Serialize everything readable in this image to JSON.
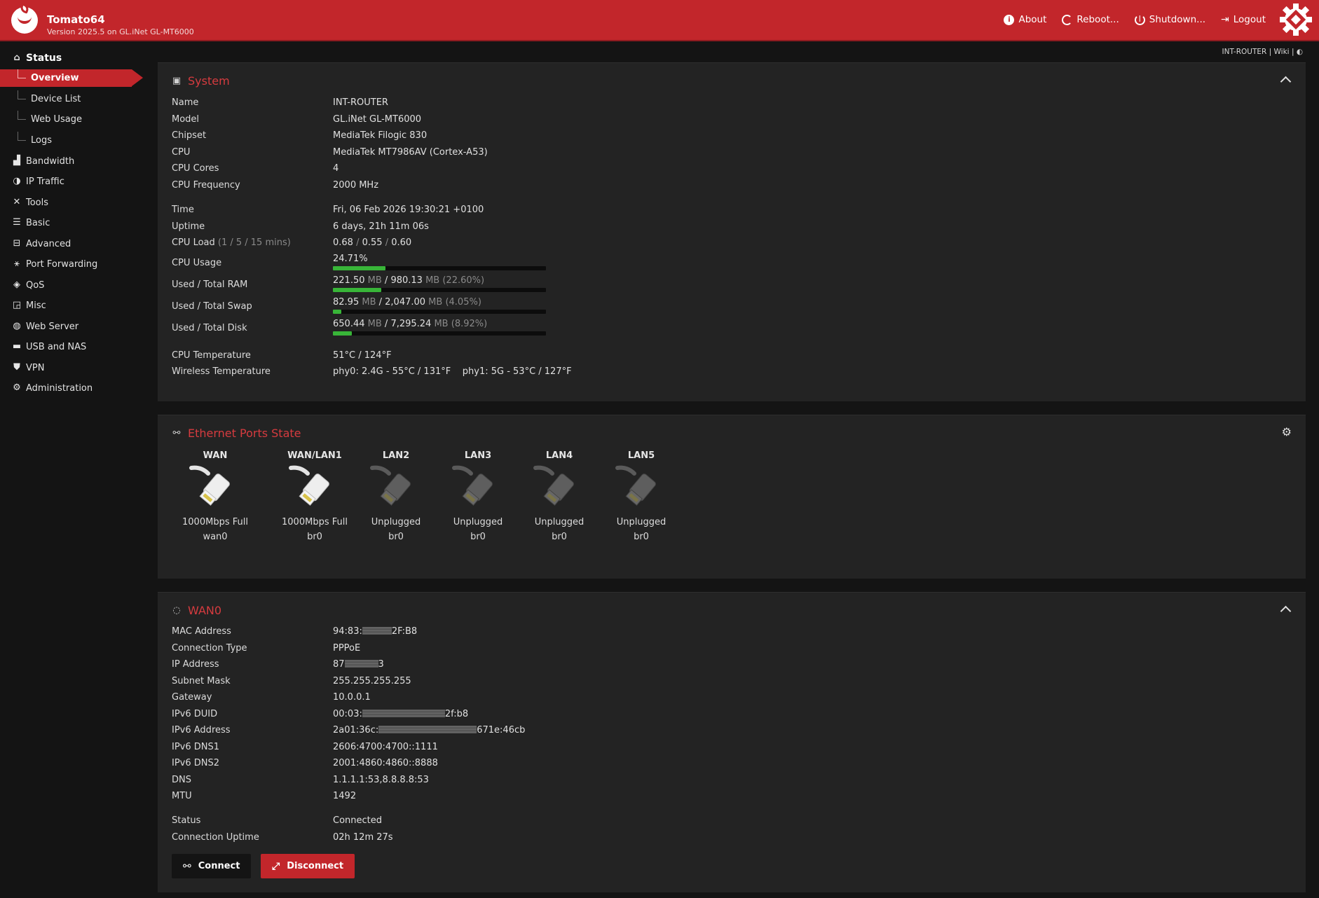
{
  "header": {
    "title": "Tomato64",
    "subtitle": "Version 2025.5 on GL.iNet GL-MT6000",
    "nav": [
      {
        "label": "About",
        "icon": "info-icon"
      },
      {
        "label": "Reboot...",
        "icon": "reboot-icon"
      },
      {
        "label": "Shutdown...",
        "icon": "power-icon"
      },
      {
        "label": "Logout",
        "icon": "logout-icon"
      }
    ],
    "colors": {
      "brand": "#c2262b",
      "accent": "#d63b3f",
      "progress": "#38b538"
    }
  },
  "toplinks": {
    "host": "INT-ROUTER",
    "sep1": " | ",
    "wiki": "Wiki",
    "sep2": " | ",
    "theme": "◐"
  },
  "sidebar": {
    "status": "Status",
    "sub": [
      "Overview",
      "Device List",
      "Web Usage",
      "Logs"
    ],
    "items": [
      "Bandwidth",
      "IP Traffic",
      "Tools",
      "Basic",
      "Advanced",
      "Port Forwarding",
      "QoS",
      "Misc",
      "Web Server",
      "USB and NAS",
      "VPN",
      "Administration"
    ]
  },
  "system": {
    "title": "System",
    "rows": [
      {
        "k": "Name",
        "v": "INT-ROUTER"
      },
      {
        "k": "Model",
        "v": "GL.iNet GL-MT6000"
      },
      {
        "k": "Chipset",
        "v": "MediaTek Filogic 830"
      },
      {
        "k": "CPU",
        "v": "MediaTek MT7986AV (Cortex-A53)"
      },
      {
        "k": "CPU Cores",
        "v": "4"
      },
      {
        "k": "CPU Frequency",
        "v": "2000 MHz"
      },
      {
        "k": "Time",
        "v": "Fri, 06 Feb 2026 19:30:21 +0100"
      },
      {
        "k": "Uptime",
        "v": "6 days, 21h 11m 06s"
      }
    ],
    "cpu_load": {
      "label": "CPU Load",
      "label_dim": " (1 / 5 / 15 mins)",
      "v1": "0.68",
      "sep": " / ",
      "v2": "0.55",
      "v3": "0.60"
    },
    "cpu_usage": {
      "label": "CPU Usage",
      "value": "24.71%",
      "fraction": 0.2471
    },
    "ram": {
      "label": "Used / Total RAM",
      "used": "221.50",
      "unit": " MB",
      "sep": " / ",
      "total": "980.13",
      "pct": " (22.60%)",
      "fraction": 0.226
    },
    "swap": {
      "label": "Used / Total Swap",
      "used": "82.95",
      "unit": " MB",
      "sep": " / ",
      "total": "2,047.00",
      "pct": " (4.05%)",
      "fraction": 0.0405
    },
    "disk": {
      "label": "Used / Total Disk",
      "used": "650.44",
      "unit": " MB",
      "sep": " / ",
      "total": "7,295.24",
      "pct": " (8.92%)",
      "fraction": 0.0892
    },
    "temps": [
      {
        "k": "CPU Temperature",
        "v": "51°C / 124°F"
      },
      {
        "k": "Wireless Temperature",
        "v": "phy0: 2.4G - 55°C / 131°F    phy1: 5G - 53°C / 127°F"
      }
    ]
  },
  "ethernet": {
    "title": "Ethernet Ports State",
    "ports": [
      {
        "name": "WAN",
        "speed": "1000Mbps Full",
        "iface": "wan0",
        "connected": true
      },
      {
        "name": "WAN/LAN1",
        "speed": "1000Mbps Full",
        "iface": "br0",
        "connected": true
      },
      {
        "name": "LAN2",
        "speed": "Unplugged",
        "iface": "br0",
        "connected": false
      },
      {
        "name": "LAN3",
        "speed": "Unplugged",
        "iface": "br0",
        "connected": false
      },
      {
        "name": "LAN4",
        "speed": "Unplugged",
        "iface": "br0",
        "connected": false
      },
      {
        "name": "LAN5",
        "speed": "Unplugged",
        "iface": "br0",
        "connected": false
      }
    ]
  },
  "wan": {
    "title": "WAN0",
    "mac": {
      "k": "MAC Address",
      "pre": "94:83:",
      "post": "2F:B8"
    },
    "conn_type": {
      "k": "Connection Type",
      "v": "PPPoE"
    },
    "ip": {
      "k": "IP Address",
      "pre": "87",
      "post": "3"
    },
    "rows": [
      {
        "k": "Subnet Mask",
        "v": "255.255.255.255"
      },
      {
        "k": "Gateway",
        "v": "10.0.0.1"
      }
    ],
    "duid": {
      "k": "IPv6 DUID",
      "pre": "00:03:",
      "post": "2f:b8"
    },
    "ipv6": {
      "k": "IPv6 Address",
      "pre": "2a01:36c:",
      "post": "671e:46cb"
    },
    "rows2": [
      {
        "k": "IPv6 DNS1",
        "v": "2606:4700:4700::1111"
      },
      {
        "k": "IPv6 DNS2",
        "v": "2001:4860:4860::8888"
      },
      {
        "k": "DNS",
        "v": "1.1.1.1:53,8.8.8.8:53"
      },
      {
        "k": "MTU",
        "v": "1492"
      }
    ],
    "status": {
      "k": "Status",
      "v": "Connected"
    },
    "uptime": {
      "k": "Connection Uptime",
      "v": "02h 12m 27s"
    },
    "connect_label": "Connect",
    "disconnect_label": "Disconnect"
  }
}
